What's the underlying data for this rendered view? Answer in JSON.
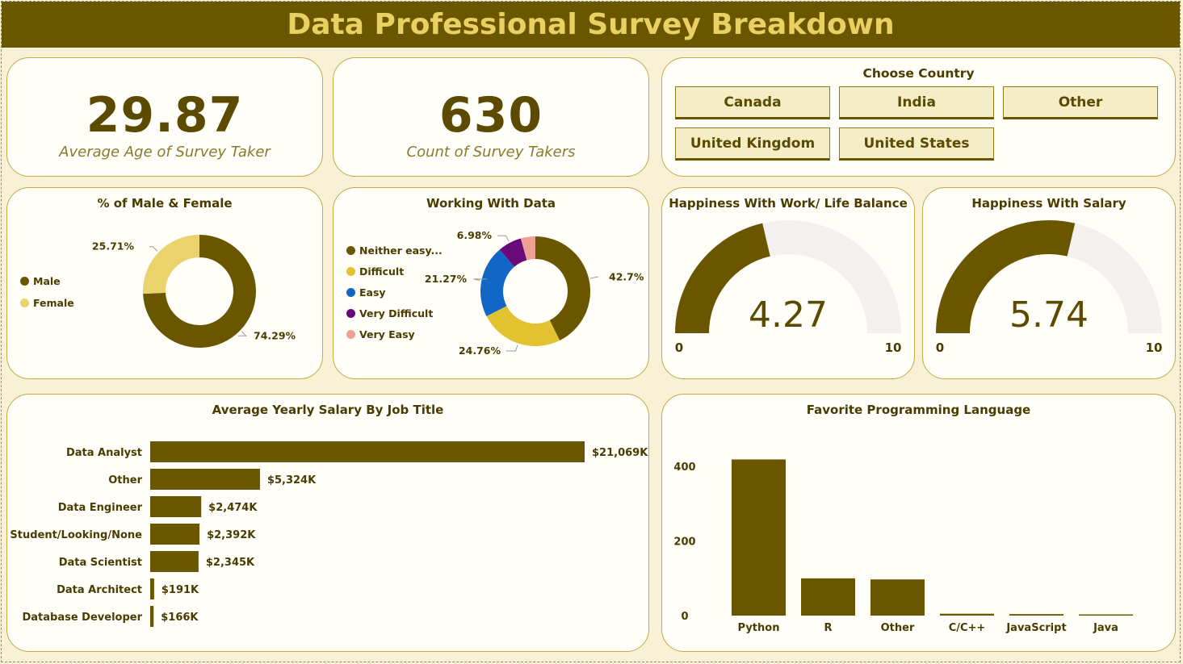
{
  "header": {
    "title": "Data Professional Survey Breakdown"
  },
  "colors": {
    "primary": "#6b5600",
    "title_text": "#e9d062",
    "background": "#f8f1d6",
    "card": "#fffef8",
    "card_border": "#c2aa44",
    "gauge_empty": "#f2f1ef"
  },
  "kpis": {
    "avg_age": {
      "value": "29.87",
      "label": "Average Age of Survey Taker"
    },
    "count": {
      "value": "630",
      "label": "Count of Survey Takers"
    }
  },
  "country_slicer": {
    "title": "Choose Country",
    "options": [
      "Canada",
      "India",
      "Other",
      "United Kingdom",
      "United States"
    ]
  },
  "gender_card": {
    "title": "% of Male & Female",
    "legend": [
      {
        "label": "Male",
        "color": "#6b5600"
      },
      {
        "label": "Female",
        "color": "#e9d36a"
      }
    ]
  },
  "working_card": {
    "title": "Working With Data",
    "legend": [
      {
        "label": "Neither easy...",
        "color": "#6b5600"
      },
      {
        "label": "Difficult",
        "color": "#e3c232"
      },
      {
        "label": "Easy",
        "color": "#1166c6"
      },
      {
        "label": "Very Difficult",
        "color": "#6a0a7a"
      },
      {
        "label": "Very Easy",
        "color": "#f0a090"
      }
    ]
  },
  "gauges": {
    "work_life": {
      "title": "Happiness With Work/ Life Balance",
      "value_text": "4.27",
      "value": 4.27,
      "min": 0,
      "max": 10,
      "min_label": "0",
      "max_label": "10"
    },
    "salary": {
      "title": "Happiness With Salary",
      "value_text": "5.74",
      "value": 5.74,
      "min": 0,
      "max": 10,
      "min_label": "0",
      "max_label": "10"
    }
  },
  "salary_card": {
    "title": "Average Yearly Salary By Job Title"
  },
  "language_card": {
    "title": "Favorite Programming Language"
  },
  "chart_data": [
    {
      "type": "pie",
      "title": "% of Male & Female",
      "categories": [
        "Male",
        "Female"
      ],
      "values": [
        74.29,
        25.71
      ],
      "labels": [
        "74.29%",
        "25.71%"
      ],
      "colors": [
        "#6b5600",
        "#e9d36a"
      ],
      "legend": "left"
    },
    {
      "type": "pie",
      "title": "Working With Data",
      "categories": [
        "Neither easy...",
        "Difficult",
        "Easy",
        "Very Difficult",
        "Very Easy"
      ],
      "values": [
        42.7,
        24.76,
        21.27,
        6.98,
        4.29
      ],
      "labels": [
        "42.7%",
        "24.76%",
        "21.27%",
        "6.98%",
        ""
      ],
      "colors": [
        "#6b5600",
        "#e3c232",
        "#1166c6",
        "#6a0a7a",
        "#f0a090"
      ],
      "legend": "left"
    },
    {
      "type": "bar",
      "orientation": "horizontal",
      "title": "Average Yearly Salary By Job Title",
      "categories": [
        "Data Analyst",
        "Other",
        "Data Engineer",
        "Student/Looking/None",
        "Data Scientist",
        "Data Architect",
        "Database Developer"
      ],
      "values": [
        21069,
        5324,
        2474,
        2392,
        2345,
        191,
        166
      ],
      "labels": [
        "$21,069K",
        "$5,324K",
        "$2,474K",
        "$2,392K",
        "$2,345K",
        "$191K",
        "$166K"
      ],
      "color": "#6b5600"
    },
    {
      "type": "bar",
      "title": "Favorite Programming Language",
      "categories": [
        "Python",
        "R",
        "Other",
        "C/C++",
        "JavaScript",
        "Java"
      ],
      "values": [
        419,
        100,
        97,
        5,
        4,
        1
      ],
      "ylim": [
        0,
        420
      ],
      "yticks": [
        "0",
        "200",
        "400"
      ],
      "color": "#6b5600",
      "grid": false
    }
  ]
}
